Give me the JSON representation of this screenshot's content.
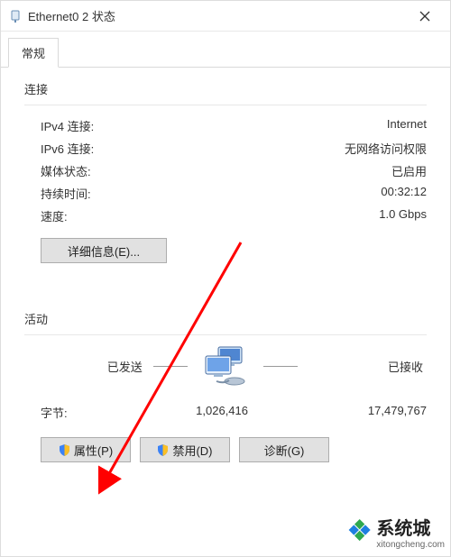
{
  "window": {
    "title": "Ethernet0 2 状态"
  },
  "tabs": {
    "general": "常规"
  },
  "connection": {
    "section_label": "连接",
    "rows": {
      "ipv4_label": "IPv4 连接:",
      "ipv4_value": "Internet",
      "ipv6_label": "IPv6 连接:",
      "ipv6_value": "无网络访问权限",
      "media_label": "媒体状态:",
      "media_value": "已启用",
      "duration_label": "持续时间:",
      "duration_value": "00:32:12",
      "speed_label": "速度:",
      "speed_value": "1.0 Gbps"
    },
    "details_btn": "详细信息(E)..."
  },
  "activity": {
    "section_label": "活动",
    "sent_label": "已发送",
    "received_label": "已接收",
    "bytes_label": "字节:",
    "bytes_sent": "1,026,416",
    "bytes_received": "17,479,767"
  },
  "buttons": {
    "properties": "属性(P)",
    "disable": "禁用(D)",
    "diagnose": "诊断(G)"
  },
  "watermark": {
    "brand": "系统城",
    "url": "xitongcheng.com"
  }
}
